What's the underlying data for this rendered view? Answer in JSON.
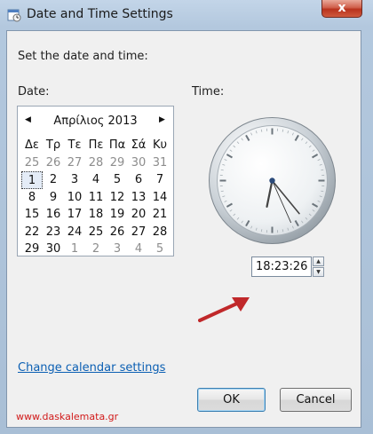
{
  "window": {
    "title": "Date and Time Settings",
    "close_glyph": "x"
  },
  "content": {
    "heading": "Set the date and time:",
    "date_label": "Date:",
    "time_label": "Time:"
  },
  "calendar": {
    "month_year": "Απρίλιος 2013",
    "prev_glyph": "◀",
    "next_glyph": "▶",
    "weekdays": [
      "Δε",
      "Τρ",
      "Τε",
      "Πε",
      "Πα",
      "Σά",
      "Κυ"
    ],
    "weeks": [
      [
        "25",
        "26",
        "27",
        "28",
        "29",
        "30",
        "31"
      ],
      [
        "1",
        "2",
        "3",
        "4",
        "5",
        "6",
        "7"
      ],
      [
        "8",
        "9",
        "10",
        "11",
        "12",
        "13",
        "14"
      ],
      [
        "15",
        "16",
        "17",
        "18",
        "19",
        "20",
        "21"
      ],
      [
        "22",
        "23",
        "24",
        "25",
        "26",
        "27",
        "28"
      ],
      [
        "29",
        "30",
        "1",
        "2",
        "3",
        "4",
        "5"
      ]
    ],
    "selected_day": "1"
  },
  "clock": {
    "hour": 18,
    "minute": 23,
    "second": 26
  },
  "time": {
    "value": "18:23:26"
  },
  "footer": {
    "link_label": "Change calendar settings",
    "ok_label": "OK",
    "cancel_label": "Cancel",
    "watermark": "www.daskalemata.gr"
  },
  "colors": {
    "accent_arrow": "#c0282a",
    "link": "#0b5fb3",
    "watermark": "#d11a1a"
  }
}
